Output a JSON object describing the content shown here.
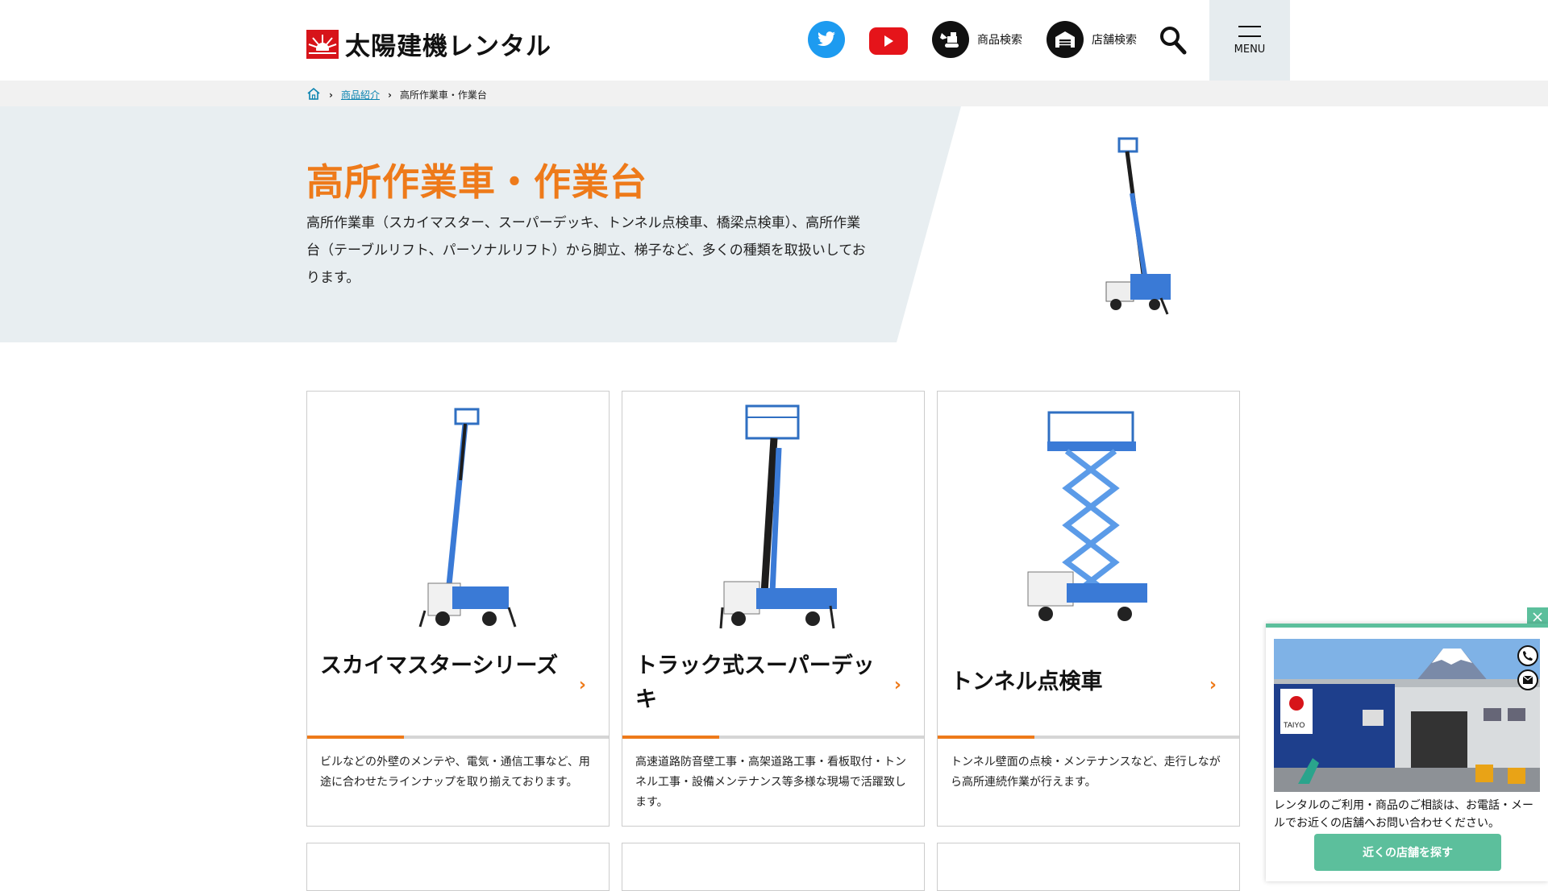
{
  "header": {
    "logo_text": "太陽建機レンタル",
    "nav_products": "商品検索",
    "nav_stores": "店舗検索",
    "menu_label": "MENU"
  },
  "breadcrumb": {
    "items": [
      "商品紹介",
      "高所作業車・作業台"
    ]
  },
  "hero": {
    "title": "高所作業車・作業台",
    "description": "高所作業車（スカイマスター、スーパーデッキ、トンネル点検車、橋梁点検車）、高所作業台（テーブルリフト、パーソナルリフト）から脚立、梯子など、多くの種類を取扱いしております。"
  },
  "cards": [
    {
      "title": "スカイマスターシリーズ",
      "description": "ビルなどの外壁のメンテや、電気・通信工事など、用途に合わせたラインナップを取り揃えております。"
    },
    {
      "title": "トラック式スーパーデッキ",
      "description": "高速道路防音壁工事・高架道路工事・看板取付・トンネル工事・設備メンテナンス等多様な現場で活躍致します。"
    },
    {
      "title": "トンネル点検車",
      "description": "トンネル壁面の点検・メンテナンスなど、走行しながら高所連続作業が行えます。"
    }
  ],
  "popup": {
    "sign_text": "TAIYO",
    "text": "レンタルのご利用・商品のご相談は、お電話・メールでお近くの店舗へお問い合わせください。",
    "button_label": "近くの店舗を探す"
  },
  "colors": {
    "accent_orange": "#ee7a1a",
    "brand_red": "#d7141a",
    "popup_green": "#5cbf9c",
    "hero_bg": "#e8eef1",
    "link_blue": "#0a83b0"
  }
}
